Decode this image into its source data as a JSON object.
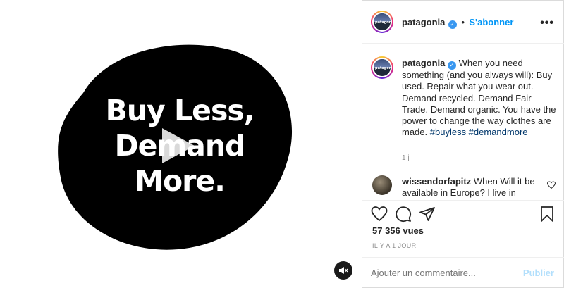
{
  "media": {
    "headline_lines": [
      "Buy Less,",
      "Demand",
      "More."
    ]
  },
  "header": {
    "username": "patagonia",
    "bullet": "•",
    "follow_label": "S'abonner",
    "more_icon": "more-horizontal-icon"
  },
  "caption": {
    "username": "patagonia",
    "text": "When you need something (and you always will): Buy used. Repair what you wear out. Demand recycled. Demand Fair Trade. Demand organic. You have the power to change the way clothes are made.",
    "hashtags": "#buyless #demandmore",
    "time": "1 j"
  },
  "comment": {
    "username": "wissendorfapitz",
    "text": "When Will it be available in Europe? I live in"
  },
  "actions": {
    "like_icon": "heart-icon",
    "comment_icon": "comment-icon",
    "share_icon": "share-icon",
    "save_icon": "bookmark-icon"
  },
  "stats": {
    "views": "57 356 vues",
    "ago": "IL Y A 1 JOUR"
  },
  "composer": {
    "placeholder": "Ajouter un commentaire...",
    "publish_label": "Publier"
  },
  "colors": {
    "accent": "#0095f6",
    "hashtag": "#00376b",
    "verified": "#3897f0",
    "muted": "#8e8e8e"
  }
}
